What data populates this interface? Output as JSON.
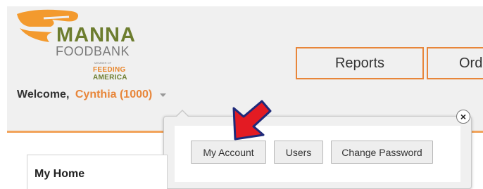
{
  "logo": {
    "name": "MANNA",
    "subname": "FOODBANK",
    "member_of": "MEMBER OF",
    "partner_line1": "FEEDING",
    "partner_line2": "AMERICA",
    "icon": "hand-icon",
    "colors": {
      "orange": "#f39a2e",
      "green": "#6d7d2f"
    }
  },
  "welcome": {
    "label": "Welcome,",
    "user": "Cynthia (1000)",
    "dropdown_icon": "caret-down-icon"
  },
  "nav": {
    "reports": "Reports",
    "orders": "Ord"
  },
  "account_menu": {
    "my_account": "My Account",
    "users": "Users",
    "change_password": "Change Password",
    "close_icon": "close-icon"
  },
  "annotation": {
    "icon": "red-arrow-pointer-icon",
    "color": "#e31b23"
  },
  "content": {
    "my_home_title": "My Home"
  },
  "colors": {
    "accent": "#e8863a",
    "header_bg": "#f0f0f0",
    "divider": "#f2a35a"
  }
}
